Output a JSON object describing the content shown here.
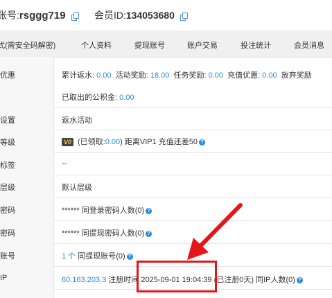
{
  "header": {
    "account_label": "账号:",
    "account_value": "rsggg719",
    "member_label": "会员ID:",
    "member_value": "134053680"
  },
  "tabs": [
    "式(需安全码解密)",
    "个人资料",
    "提现账号",
    "账户交易",
    "投注统计",
    "会员消息"
  ],
  "rows": {
    "discount": {
      "label": "优惠",
      "line1": [
        {
          "k": "累计返水:",
          "v": "0.00"
        },
        {
          "k": "活动奖励:",
          "v": "18.00"
        },
        {
          "k": "任务奖励:",
          "v": "0.00"
        },
        {
          "k": "充值优惠:",
          "v": "0.00"
        },
        {
          "k": "放弃奖励",
          "v": ""
        }
      ],
      "line2_label": "已取出的公积金:",
      "line2_value": "0.00"
    },
    "setting": {
      "label": "设置",
      "value": "返水活动"
    },
    "level": {
      "label": "等级",
      "badge": "V0",
      "pre": "(已领取:",
      "claimed": "0.00",
      "post": ")  距离VIP1 充值还差",
      "gap": "50"
    },
    "tag": {
      "label": "标签",
      "value": "--"
    },
    "layer": {
      "label": "层级",
      "value": "默认层级"
    },
    "login_pwd": {
      "label": "密码",
      "value": "****** 同登录密码人数(0)"
    },
    "withdraw_pwd": {
      "label": "密码",
      "value": "****** 同提现密码人数(0)"
    },
    "account": {
      "label": "账号",
      "count": "1 个",
      "value": " 同提现账号(0)"
    },
    "ip": {
      "label": "IP",
      "ip": "60.163.203.3",
      "reg_label": " 注册时间 ",
      "reg_time": "2025-09-01 19:04:39",
      "reg_days": " (已注册0天)",
      "same_ip": "  同IP人数(0)"
    }
  },
  "colors": {
    "link": "#2a8bd8",
    "highlight": "#e5161b",
    "badge_bg": "#444444",
    "badge_fg": "#f3c44a"
  }
}
